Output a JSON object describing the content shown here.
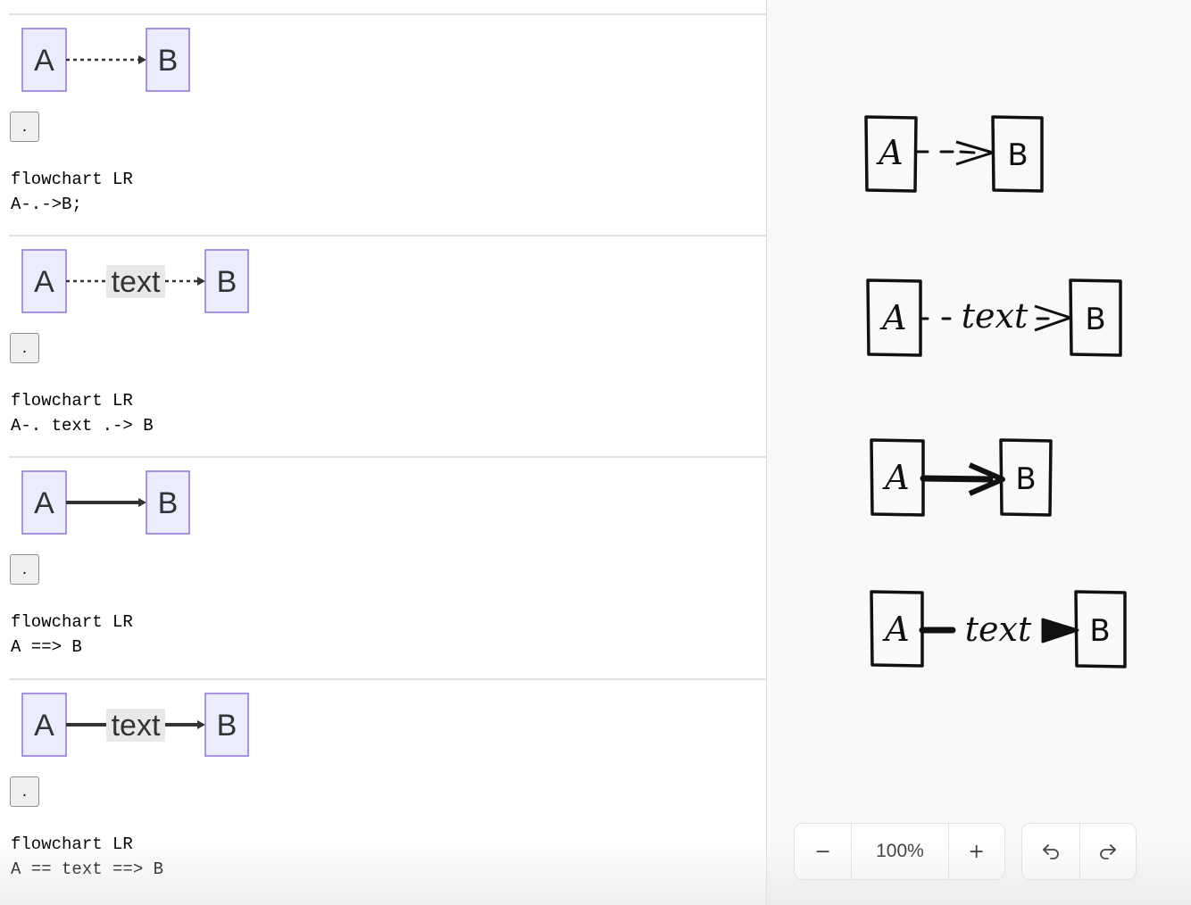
{
  "examples": [
    {
      "node_a": "A",
      "node_b": "B",
      "edge_label": "",
      "button_label": ".",
      "code_line1": "flowchart LR",
      "code_line2": "A-.->B;"
    },
    {
      "node_a": "A",
      "node_b": "B",
      "edge_label": "text",
      "button_label": ".",
      "code_line1": "flowchart LR",
      "code_line2": "A-. text .-> B"
    },
    {
      "node_a": "A",
      "node_b": "B",
      "edge_label": "",
      "button_label": ".",
      "code_line1": "flowchart LR",
      "code_line2": "A ==> B"
    },
    {
      "node_a": "A",
      "node_b": "B",
      "edge_label": "text",
      "button_label": ".",
      "code_line1": "flowchart LR",
      "code_line2": "A == text ==> B"
    }
  ],
  "canvas": {
    "diagrams": [
      {
        "node_a": "A",
        "node_b": "B",
        "edge_label": ""
      },
      {
        "node_a": "A",
        "node_b": "B",
        "edge_label": "text"
      },
      {
        "node_a": "A",
        "node_b": "B",
        "edge_label": ""
      },
      {
        "node_a": "A",
        "node_b": "B",
        "edge_label": "text"
      }
    ]
  },
  "toolbar": {
    "zoom_out_icon": "minus-icon",
    "zoom_out_glyph": "−",
    "zoom_level": "100%",
    "zoom_in_icon": "plus-icon",
    "zoom_in_glyph": "+",
    "undo_icon": "undo-icon",
    "redo_icon": "redo-icon"
  },
  "colors": {
    "node_fill": "#ececff",
    "node_stroke": "#9370db",
    "edge_label_bg": "#e8e8e8",
    "canvas_bg": "#f9f9f9"
  }
}
